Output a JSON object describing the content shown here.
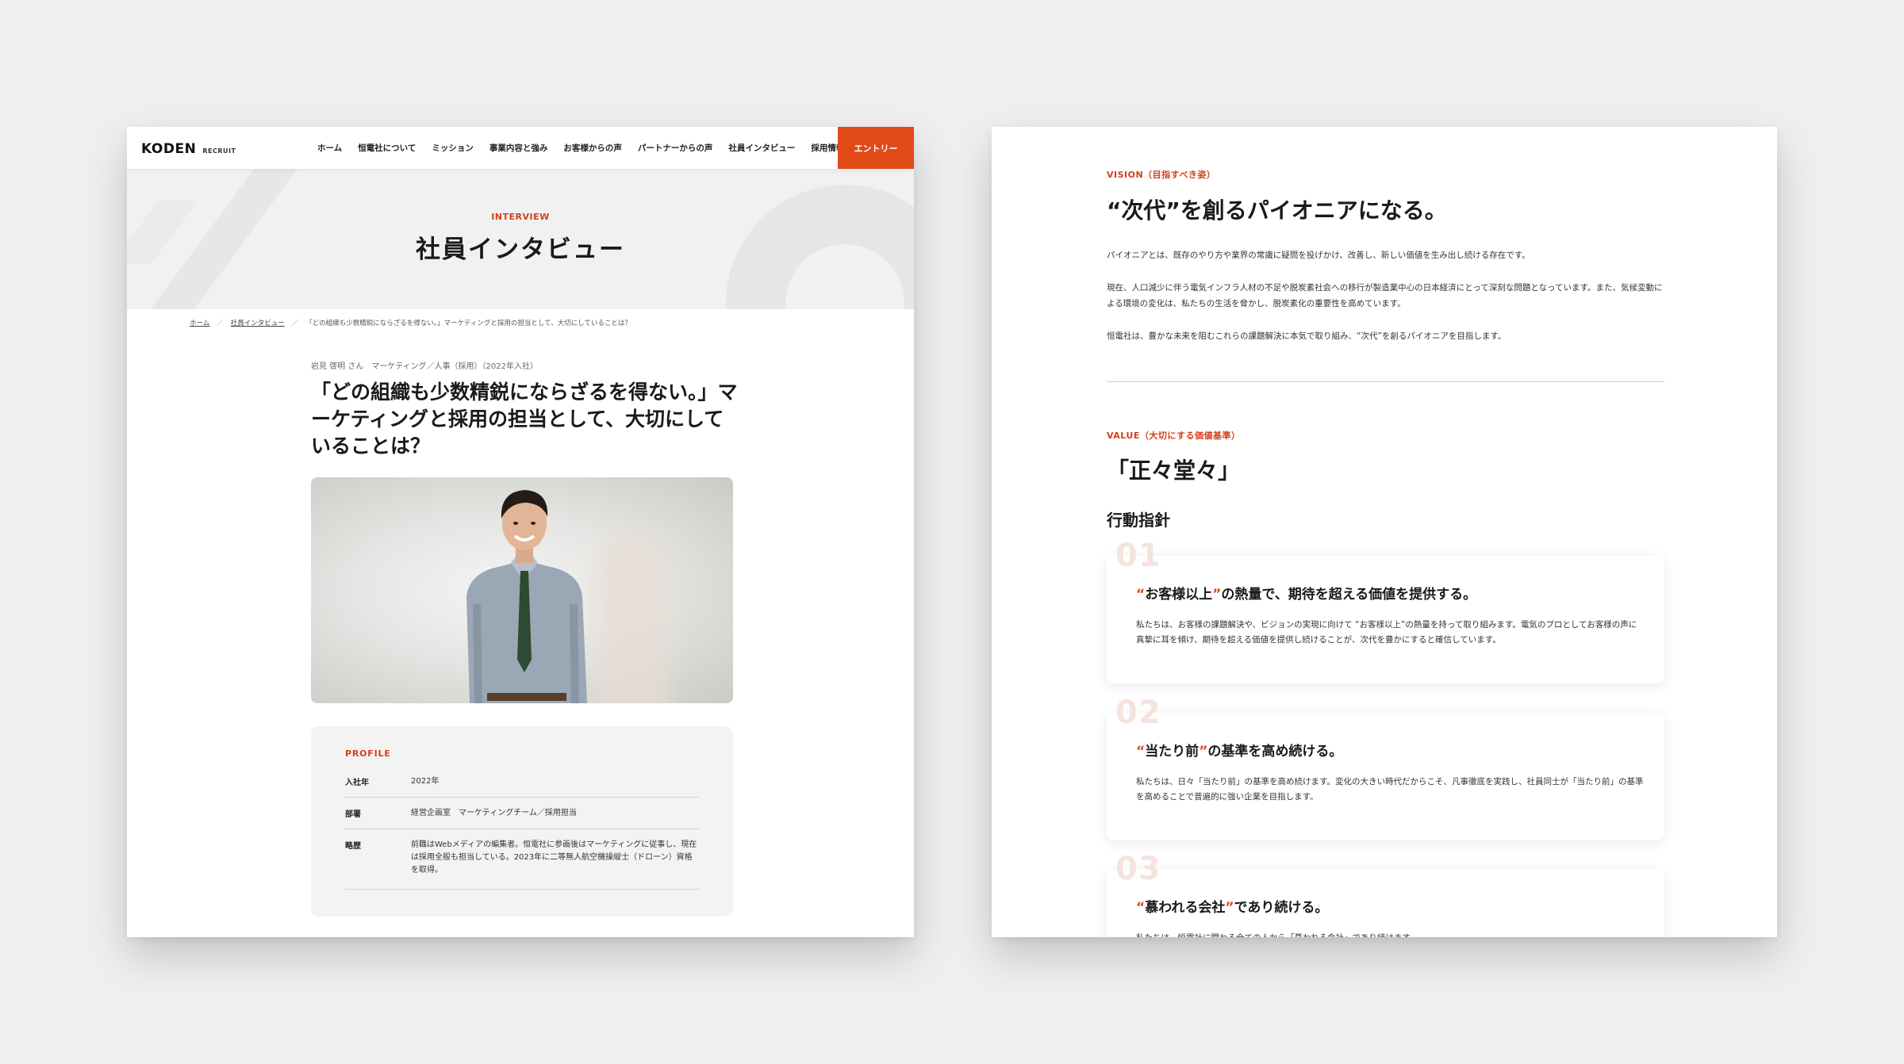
{
  "left": {
    "logo": {
      "mark": "KODEN",
      "sub": "RECRUIT"
    },
    "nav": [
      "ホーム",
      "恒電社について",
      "ミッション",
      "事業内容と強み",
      "お客様からの声",
      "パートナーからの声",
      "社員インタビュー",
      "採用情報"
    ],
    "entry_label": "エントリー",
    "hero": {
      "eyebrow": "INTERVIEW",
      "title": "社員インタビュー"
    },
    "breadcrumb": {
      "home": "ホーム",
      "parent": "社員インタビュー",
      "current": "「どの組織も少数精鋭にならざるを得ない。」マーケティングと採用の担当として、大切にしていることは？",
      "sep": "／"
    },
    "article": {
      "meta": "岩見 啓明 さん　マーケティング／人事（採用）（2022年入社）",
      "title": "「どの組織も少数精鋭にならざるを得ない。」マーケティングと採用の担当として、大切にしていることは？"
    },
    "profile": {
      "label": "PROFILE",
      "rows": [
        {
          "key": "入社年",
          "value": "2022年"
        },
        {
          "key": "部署",
          "value": "経営企画室　マーケティングチーム／採用担当"
        },
        {
          "key": "略歴",
          "value": "前職はWebメディアの編集者。恒電社に参画後はマーケティングに従事し、現在は採用全般も担当している。2023年に二等無人航空機操縦士（ドローン）資格を取得。"
        }
      ]
    }
  },
  "right": {
    "vision": {
      "eyebrow": "VISION（目指すべき姿）",
      "title": "“次代”を創るパイオニアになる。",
      "paragraphs": [
        "パイオニアとは、既存のやり方や業界の常識に疑問を投げかけ、改善し、新しい価値を生み出し続ける存在です。",
        "現在、人口減少に伴う電気インフラ人材の不足や脱炭素社会への移行が製造業中心の日本経済にとって深刻な問題となっています。また、気候変動による環境の変化は、私たちの生活を脅かし、脱炭素化の重要性を高めています。",
        "恒電社は、豊かな未来を阻むこれらの課題解決に本気で取り組み、“次代”を創るパイオニアを目指します。"
      ]
    },
    "value": {
      "eyebrow": "VALUE（大切にする価値基準）",
      "title": "「正々堂々」",
      "subtitle": "行動指針"
    },
    "cards": [
      {
        "num": "01",
        "q_open": "“",
        "highlight": "お客様以上",
        "q_close": "”",
        "rest": "の熱量で、期待を超える価値を提供する。",
        "body": "私たちは、お客様の課題解決や、ビジョンの実現に向けて “お客様以上”の熱量を持って取り組みます。電気のプロとしてお客様の声に真摯に耳を傾け、期待を超える価値を提供し続けることが、次代を豊かにすると確信しています。"
      },
      {
        "num": "02",
        "q_open": "“",
        "highlight": "当たり前",
        "q_close": "”",
        "rest": "の基準を高め続ける。",
        "body": "私たちは、日々「当たり前」の基準を高め続けます。変化の大きい時代だからこそ、凡事徹底を実践し、社員同士が「当たり前」の基準を高めることで普遍的に強い企業を目指します。"
      },
      {
        "num": "03",
        "q_open": "“",
        "highlight": "慕われる会社",
        "q_close": "”",
        "rest": "であり続ける。",
        "body": "私たちは、恒電社に関わる全ての人から「慕われる会社」であり続けます。"
      }
    ]
  },
  "colors": {
    "accent": "#e04a17",
    "page_bg": "#efefef"
  }
}
